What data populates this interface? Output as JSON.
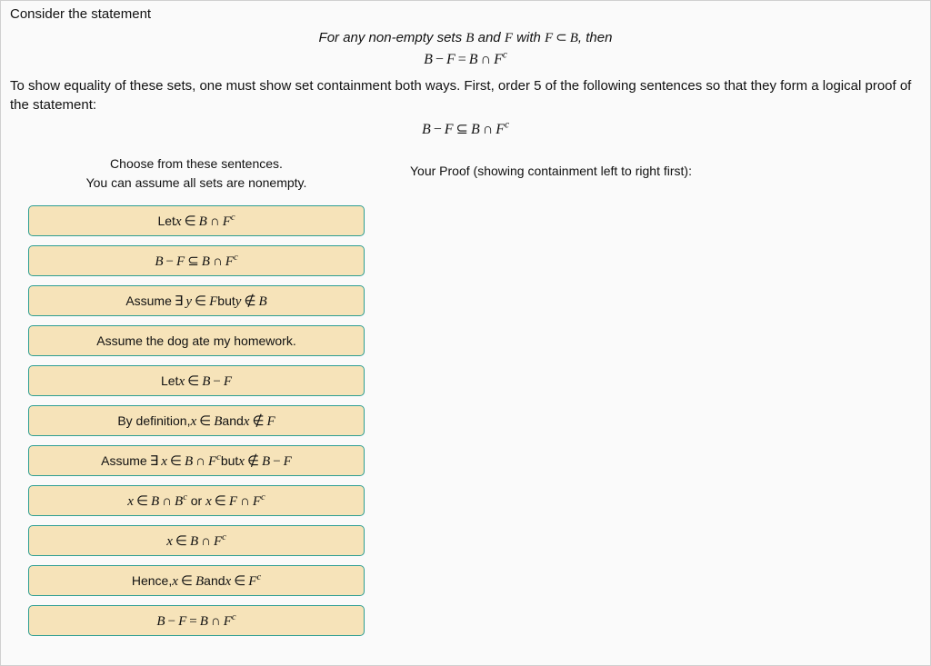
{
  "intro": "Consider the statement",
  "statement_prefix": "For any non-empty sets ",
  "statement_mid1": " and ",
  "statement_mid2": " with ",
  "statement_suffix": ", then",
  "sym": {
    "B": "B",
    "F": "F",
    "Fc": "F",
    "Bc": "B",
    "sup_c": "c",
    "minus": "−",
    "eq": "=",
    "cap": "∩",
    "subset": "⊂",
    "subseteq": "⊆",
    "in": "∈",
    "notin": "∉",
    "exists": "∃",
    "or": "or",
    "x": "x",
    "y": "y"
  },
  "body_text": "To show equality of these sets, one must show set containment both ways. First, order 5 of the following sentences so that they form a logical proof of the statement:",
  "left_head_line1": "Choose from these sentences.",
  "left_head_line2": "You can assume all sets are nonempty.",
  "right_head": "Your Proof (showing containment left to right first):",
  "tiles": {
    "t1_pre": "Let ",
    "t3_pre": "Assume ",
    "t3_mid": " but ",
    "t4": "Assume the dog ate my homework.",
    "t5_pre": "Let ",
    "t6_pre": "By definition, ",
    "t6_mid": " and ",
    "t7_pre": "Assume ",
    "t7_mid": " but ",
    "t8_mid": " or ",
    "t10_pre": "Hence, ",
    "t10_mid": " and "
  }
}
